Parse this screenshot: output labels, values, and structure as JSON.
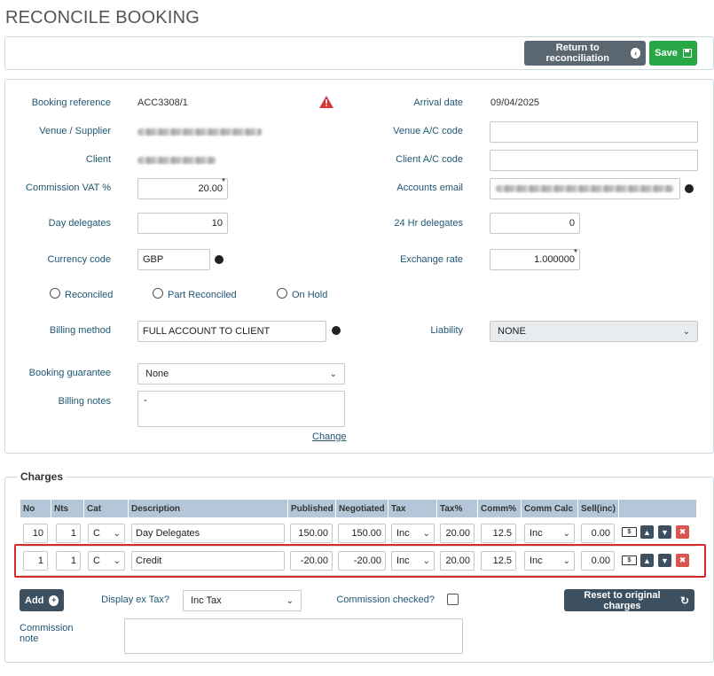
{
  "page": {
    "title": "RECONCILE BOOKING"
  },
  "toolbar": {
    "return_label": "Return to reconciliation",
    "save_label": "Save"
  },
  "booking": {
    "booking_reference_label": "Booking reference",
    "booking_reference_value": "ACC3308/1",
    "arrival_date_label": "Arrival date",
    "arrival_date_value": "09/04/2025",
    "venue_supplier_label": "Venue / Supplier",
    "venue_ac_label": "Venue A/C code",
    "venue_ac_value": "",
    "client_label": "Client",
    "client_ac_label": "Client A/C code",
    "client_ac_value": "",
    "commission_vat_label": "Commission VAT %",
    "commission_vat_value": "20.00",
    "accounts_email_label": "Accounts email",
    "day_delegates_label": "Day delegates",
    "day_delegates_value": "10",
    "hr24_delegates_label": "24 Hr delegates",
    "hr24_delegates_value": "0",
    "currency_code_label": "Currency code",
    "currency_code_value": "GBP",
    "exchange_rate_label": "Exchange rate",
    "exchange_rate_value": "1.000000",
    "required_marker": "*",
    "status_options": [
      "Reconciled",
      "Part Reconciled",
      "On Hold"
    ],
    "billing_method_label": "Billing method",
    "billing_method_value": "FULL ACCOUNT TO CLIENT",
    "liability_label": "Liability",
    "liability_value": "NONE",
    "booking_guarantee_label": "Booking guarantee",
    "booking_guarantee_value": "None",
    "billing_notes_label": "Billing notes",
    "billing_notes_value": "-",
    "change_link": "Change"
  },
  "charges": {
    "legend": "Charges",
    "columns": [
      "No",
      "Nts",
      "Cat",
      "Description",
      "Published",
      "Negotiated",
      "Tax",
      "Tax%",
      "Comm%",
      "Comm Calc",
      "Sell(inc)"
    ],
    "rows": [
      {
        "no": "10",
        "nts": "1",
        "cat": "C",
        "description": "Day Delegates",
        "published": "150.00",
        "negotiated": "150.00",
        "tax": "Inc",
        "tax_pct": "20.00",
        "comm_pct": "12.5",
        "comm_calc": "Inc",
        "sell": "0.00"
      },
      {
        "no": "1",
        "nts": "1",
        "cat": "C",
        "description": "Credit",
        "published": "-20.00",
        "negotiated": "-20.00",
        "tax": "Inc",
        "tax_pct": "20.00",
        "comm_pct": "12.5",
        "comm_calc": "Inc",
        "sell": "0.00"
      }
    ],
    "add_label": "Add",
    "display_ex_tax_label": "Display ex Tax?",
    "display_ex_tax_value": "Inc Tax",
    "commission_checked_label": "Commission checked?",
    "reset_label": "Reset to original charges",
    "commission_note_label": "Commission note",
    "commission_note_value": ""
  },
  "colors": {
    "label": "#1f5673",
    "header_bg": "#b3c7d8",
    "save": "#27a745",
    "highlight": "#d62a2a",
    "warning": "#d9383a"
  },
  "icons": [
    "warning-icon",
    "globe-icon",
    "chevron-left-circle-icon",
    "floppy-disk-icon",
    "plus-circle-icon",
    "refresh-icon",
    "money-icon",
    "arrow-up-icon",
    "arrow-down-icon",
    "trash-icon"
  ]
}
